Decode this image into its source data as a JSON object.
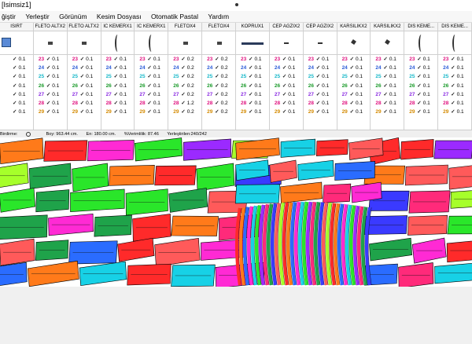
{
  "window": {
    "title": "[Isimsiz1]"
  },
  "menu": [
    "ğiştir",
    "Yerleştir",
    "Görünüm",
    "Kesim Dosyası",
    "Otomatik Pastal",
    "Yardım"
  ],
  "columns": [
    {
      "header": "ISIRT",
      "shape": "flat-icon",
      "checks": [
        "0.1",
        "0.1",
        "0.1",
        "0.1",
        "0.1",
        "0.1",
        "0.1"
      ]
    },
    {
      "header": "FLETO ALTX2",
      "shape": "small-rect-icon",
      "checks": [
        "0.1",
        "0.1",
        "0.1",
        "0.1",
        "0.1",
        "0.1",
        "0.1"
      ]
    },
    {
      "header": "FLETO ALTX2",
      "shape": "small-rect-icon",
      "checks": [
        "0.1",
        "0.1",
        "0.1",
        "0.1",
        "0.1",
        "0.1",
        "0.1"
      ]
    },
    {
      "header": "IC KEMERX1",
      "shape": "curve-icon",
      "checks": [
        "0.1",
        "0.1",
        "0.1",
        "0.1",
        "0.1",
        "0.1",
        "0.1"
      ]
    },
    {
      "header": "IC KEMERX1",
      "shape": "curve-icon",
      "checks": [
        "0.1",
        "0.1",
        "0.1",
        "0.1",
        "0.1",
        "0.1",
        "0.1"
      ]
    },
    {
      "header": "FLETOX4",
      "shape": "small-rect-icon",
      "checks": [
        "0.2",
        "0.2",
        "0.2",
        "0.2",
        "0.2",
        "1.2",
        "0.2"
      ]
    },
    {
      "header": "FLETOX4",
      "shape": "small-rect-icon",
      "checks": [
        "0.2",
        "0.2",
        "0.2",
        "0.2",
        "0.2",
        "0.2",
        "0.2"
      ]
    },
    {
      "header": "KOPRUX1",
      "shape": "bar-icon",
      "checks": [
        "0.1",
        "0.1",
        "0.1",
        "0.1",
        "0.1",
        "0.1",
        "0.1"
      ]
    },
    {
      "header": "CEP AGZIX2",
      "shape": "small-dash-icon",
      "checks": [
        "0.1",
        "0.1",
        "0.1",
        "0.1",
        "0.1",
        "0.1",
        "0.1"
      ]
    },
    {
      "header": "CEP AGZIX2",
      "shape": "small-dash-icon",
      "checks": [
        "0.1",
        "0.1",
        "0.1",
        "0.1",
        "0.1",
        "0.1",
        "0.1"
      ]
    },
    {
      "header": "KARSILIKX2",
      "shape": "angle-icon",
      "checks": [
        "0.1",
        "0.1",
        "0.1",
        "0.1",
        "0.1",
        "0.1",
        "0.1"
      ]
    },
    {
      "header": "KARSILIKX2",
      "shape": "angle-icon",
      "checks": [
        "0.1",
        "0.1",
        "0.1",
        "0.1",
        "0.1",
        "0.1",
        "0.1"
      ]
    },
    {
      "header": "DIS KEME...",
      "shape": "curve-icon",
      "checks": [
        "0.1",
        "0.1",
        "0.1",
        "0.1",
        "0.1",
        "0.1",
        "0.1"
      ]
    },
    {
      "header": "DIS KEME...",
      "shape": "curve-icon",
      "checks": [
        "0.1",
        "0.1",
        "0.1",
        "0.1",
        "0.1",
        "0.1",
        "0.1"
      ]
    }
  ],
  "size_rows": [
    {
      "size": "23",
      "color": "#e0107e"
    },
    {
      "size": "24",
      "color": "#2a5bd7"
    },
    {
      "size": "25",
      "color": "#17b8c9"
    },
    {
      "size": "26",
      "color": "#1a9a2a"
    },
    {
      "size": "27",
      "color": "#8a2be2"
    },
    {
      "size": "28",
      "color": "#e0107e"
    },
    {
      "size": "29",
      "color": "#d48a00"
    }
  ],
  "status": {
    "birdirme_label": "Birdirme:",
    "boy": "Boy: 963.44  cm.",
    "en": "En: 180.00  cm.",
    "verimlilik": "%Verimlilik: 87.46",
    "yerlestirilen": "Yerleştirilen:240/242"
  },
  "marker": {
    "piece_colors": [
      "#ff2a2a",
      "#ff7a1a",
      "#2a6cff",
      "#ff2ad4",
      "#17d1e6",
      "#2ae62a",
      "#9b2aff",
      "#ff2a7a",
      "#1fa34a",
      "#3a3aff",
      "#ff5a5a",
      "#a6ff2a"
    ]
  }
}
